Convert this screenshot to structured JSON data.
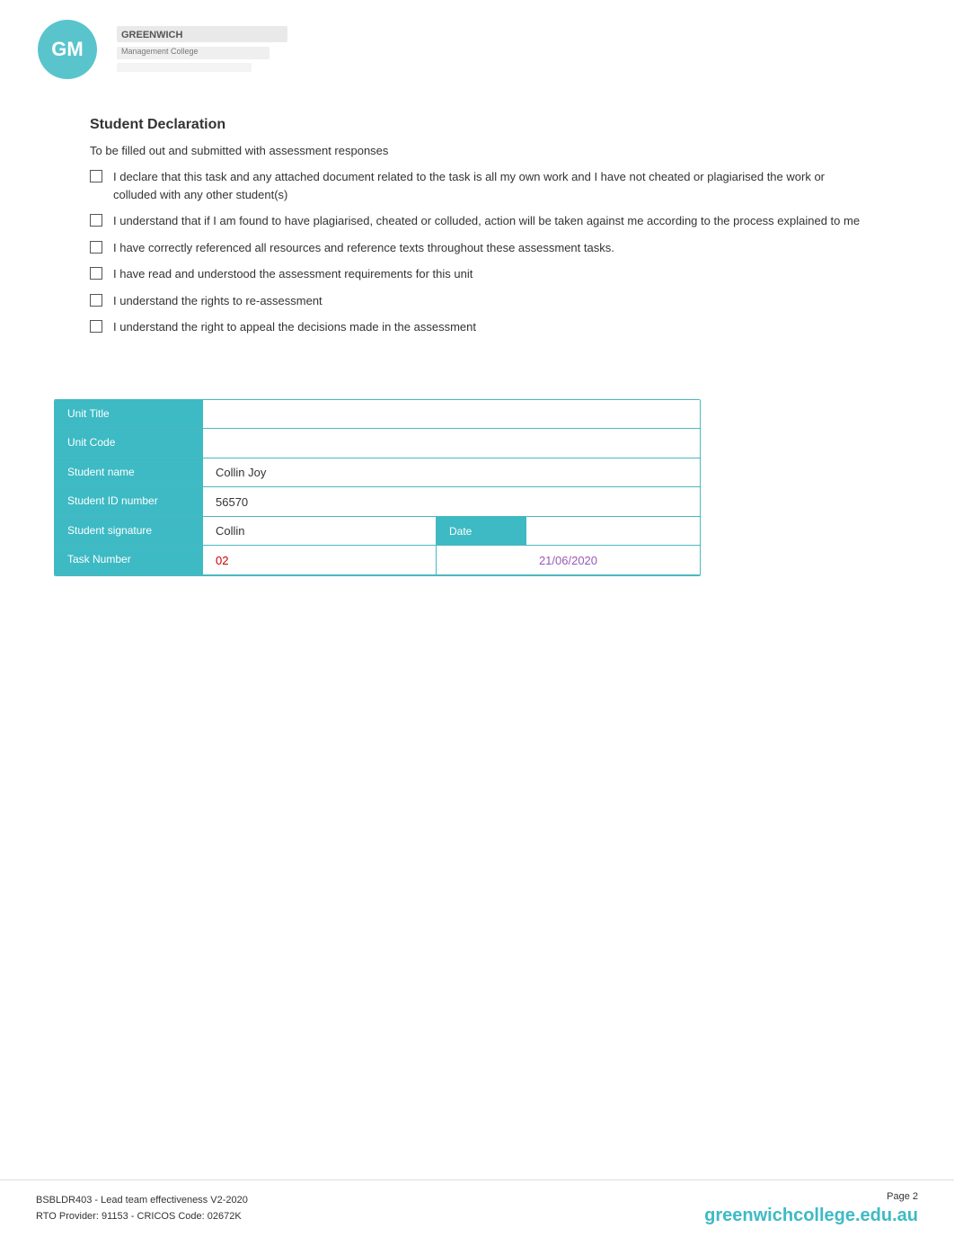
{
  "header": {
    "logo_alt": "Greenwich Management College Logo"
  },
  "student_declaration": {
    "title": "Student Declaration",
    "subtitle": "To be filled out and submitted with assessment responses",
    "items": [
      "I declare that this task and any attached document related to the task is all my own work and I have not cheated or plagiarised the work or colluded with any other student(s)",
      "I understand that if I am found to have plagiarised, cheated or colluded, action will be taken against me according to the process explained to me",
      "I have correctly referenced all resources and reference texts throughout these assessment tasks.",
      "I have read and understood the assessment requirements for this unit",
      "I understand the rights to re-assessment",
      "I understand the right to appeal the decisions made in the assessment"
    ]
  },
  "info_table": {
    "unit_title_label": "Unit Title",
    "unit_title_value": "",
    "unit_code_label": "Unit Code",
    "unit_code_value": "",
    "student_name_label": "Student name",
    "student_name_value": "Collin Joy",
    "student_id_label": "Student ID number",
    "student_id_value": "56570",
    "student_sig_label": "Student signature",
    "student_sig_value": "Collin",
    "date_label": "Date",
    "date_value": "",
    "task_number_label": "Task Number",
    "task_number_value": "02",
    "date_actual_value": "21/06/2020"
  },
  "footer": {
    "line1": "BSBLDR403 - Lead team effectiveness V2-2020",
    "line2": "RTO Provider: 91153       - CRICOS    Code: 02672K",
    "page_label": "Page 2",
    "website_green": "greenwichcollege.",
    "website_teal": "edu.au"
  }
}
